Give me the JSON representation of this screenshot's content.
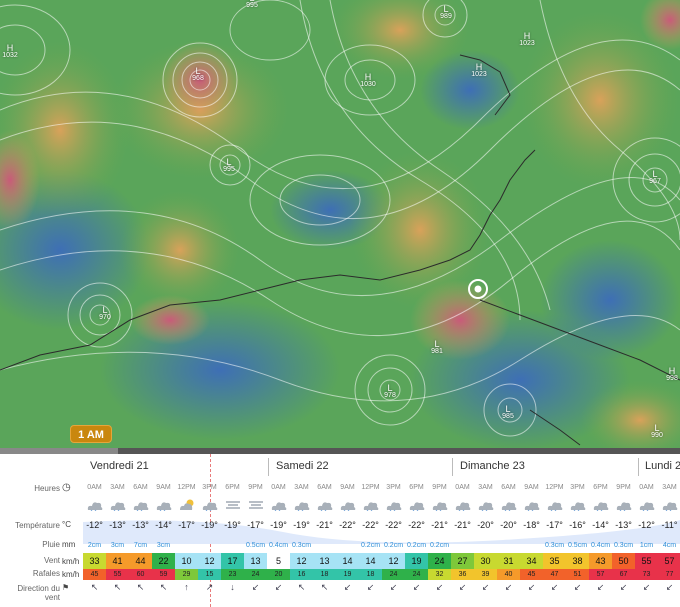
{
  "map": {
    "time_badge": "1 AM",
    "pressure_systems": [
      {
        "id": "h1032",
        "type": "H",
        "value": "1032"
      },
      {
        "id": "l995a",
        "type": "L",
        "value": "995"
      },
      {
        "id": "l989",
        "type": "L",
        "value": "989"
      },
      {
        "id": "h1023a",
        "type": "H",
        "value": "1023"
      },
      {
        "id": "h1023b",
        "type": "H",
        "value": "1023"
      },
      {
        "id": "h1030",
        "type": "H",
        "value": "1030"
      },
      {
        "id": "l968",
        "type": "L",
        "value": "968"
      },
      {
        "id": "l995b",
        "type": "L",
        "value": "995"
      },
      {
        "id": "l967",
        "type": "L",
        "value": "967"
      },
      {
        "id": "l970",
        "type": "L",
        "value": "970"
      },
      {
        "id": "l981",
        "type": "L",
        "value": "981"
      },
      {
        "id": "l978",
        "type": "L",
        "value": "978"
      },
      {
        "id": "l985",
        "type": "L",
        "value": "985"
      },
      {
        "id": "l990",
        "type": "L",
        "value": "990"
      },
      {
        "id": "h998",
        "type": "H",
        "value": "998"
      }
    ]
  },
  "forecast": {
    "days": [
      "Vendredi 21",
      "Samedi 22",
      "Dimanche 23",
      "Lundi 2"
    ],
    "labels": {
      "hours": "Heures",
      "temperature": "Température",
      "rain": "Pluie",
      "wind": "Vent",
      "gusts": "Rafales",
      "direction": "Direction du vent"
    },
    "units": {
      "temperature": "°C",
      "rain": "mm",
      "wind": "km/h",
      "gusts": "km/h"
    },
    "hours": [
      "0AM",
      "3AM",
      "6AM",
      "9AM",
      "12PM",
      "3PM",
      "6PM",
      "9PM",
      "0AM",
      "3AM",
      "6AM",
      "9AM",
      "12PM",
      "3PM",
      "6PM",
      "9PM",
      "0AM",
      "3AM",
      "6AM",
      "9AM",
      "12PM",
      "3PM",
      "6PM",
      "9PM",
      "0AM",
      "3AM"
    ],
    "icons": [
      "cloud",
      "cloud",
      "cloud",
      "cloud",
      "sun-cloud",
      "cloud",
      "fog",
      "fog",
      "cloud",
      "cloud",
      "cloud",
      "cloud",
      "cloud",
      "cloud",
      "cloud",
      "cloud",
      "cloud",
      "cloud",
      "cloud",
      "cloud",
      "cloud",
      "cloud",
      "cloud",
      "cloud",
      "cloud",
      "cloud"
    ],
    "temperatures": [
      "-12°",
      "-13°",
      "-13°",
      "-14°",
      "-17°",
      "-19°",
      "-19°",
      "-17°",
      "-19°",
      "-19°",
      "-21°",
      "-22°",
      "-22°",
      "-22°",
      "-22°",
      "-21°",
      "-21°",
      "-20°",
      "-20°",
      "-18°",
      "-17°",
      "-16°",
      "-14°",
      "-13°",
      "-12°",
      "-11°"
    ],
    "rain": [
      "2cm",
      "3cm",
      "7cm",
      "3cm",
      "",
      "",
      "",
      "0.5cm",
      "0.4cm",
      "0.3cm",
      "",
      "",
      "0.2cm",
      "0.2cm",
      "0.2cm",
      "0.2cm",
      "",
      "",
      "",
      "",
      "0.3cm",
      "0.5cm",
      "0.4cm",
      "0.3cm",
      "1cm",
      "4cm"
    ],
    "wind": [
      "33",
      "41",
      "44",
      "22",
      "10",
      "12",
      "17",
      "13",
      "5",
      "12",
      "13",
      "14",
      "14",
      "12",
      "19",
      "24",
      "27",
      "30",
      "31",
      "34",
      "35",
      "38",
      "43",
      "50",
      "55",
      "57"
    ],
    "gusts": [
      "45",
      "55",
      "60",
      "59",
      "29",
      "15",
      "23",
      "24",
      "20",
      "16",
      "18",
      "19",
      "18",
      "24",
      "24",
      "32",
      "36",
      "39",
      "40",
      "45",
      "47",
      "51",
      "57",
      "67",
      "73",
      "77"
    ],
    "direction": [
      "↖",
      "↖",
      "↖",
      "↖",
      "↑",
      "↗",
      "↓",
      "↙",
      "↙",
      "↖",
      "↖",
      "↙",
      "↙",
      "↙",
      "↙",
      "↙",
      "↙",
      "↙",
      "↙",
      "↙",
      "↙",
      "↙",
      "↙",
      "↙",
      "↙",
      "↙"
    ]
  }
}
